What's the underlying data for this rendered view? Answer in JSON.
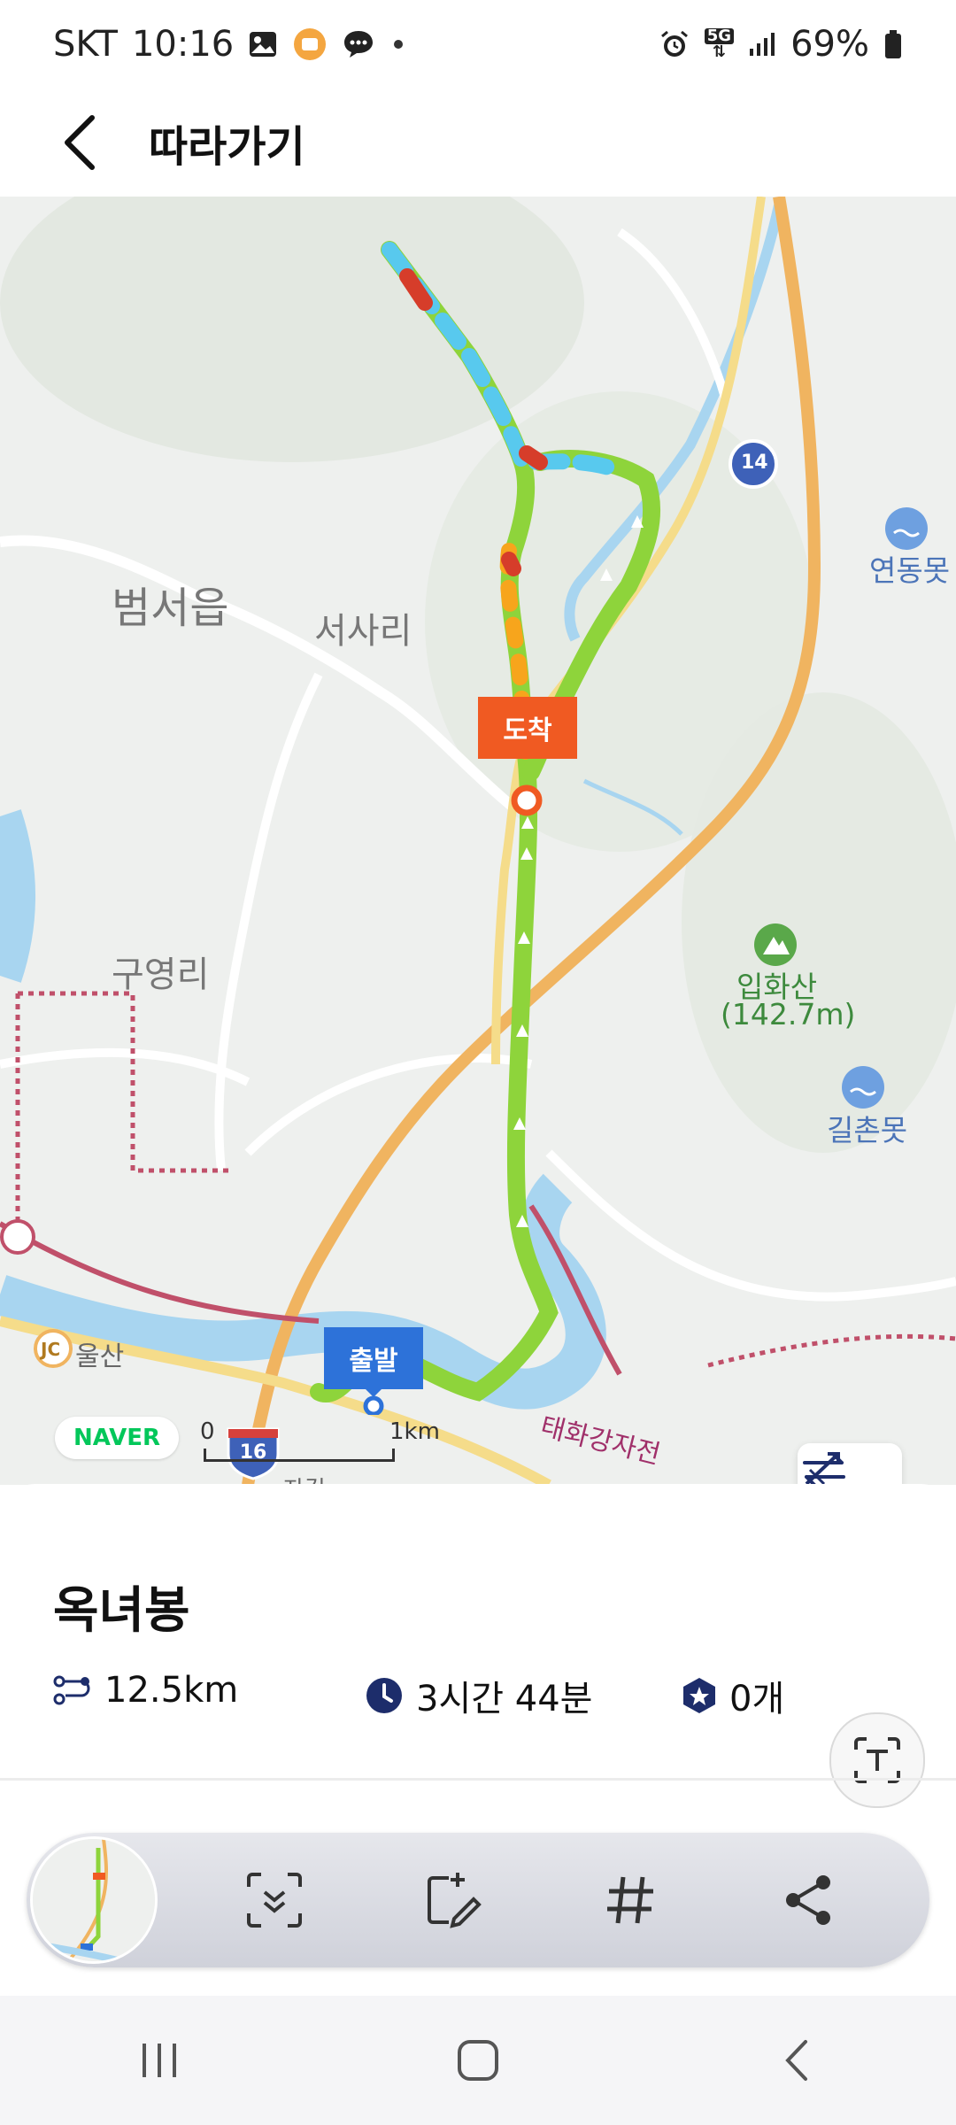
{
  "status": {
    "carrier": "SKT",
    "time": "10:16",
    "network": "5G",
    "battery": "69%",
    "left_icons": [
      "gallery-icon",
      "app-badge-icon",
      "message-icon",
      "dot-icon"
    ],
    "right_icons": [
      "alarm-icon",
      "5g-icon",
      "signal-icon",
      "battery-icon"
    ]
  },
  "header": {
    "title": "따라가기"
  },
  "map": {
    "labels": {
      "beomseo": "범서읍",
      "seosa": "서사리",
      "guyeong": "구영리",
      "ulsan": "울산",
      "jc": "JC",
      "yeondong": "연동못",
      "iphwa": "입화산",
      "iphwa_height": "(142.7m)",
      "gilchon": "길촌못",
      "road_14": "14",
      "road_16": "16",
      "taehwa": "태화강자전",
      "jagil": "자길"
    },
    "markers": {
      "arrive": "도착",
      "start": "출발"
    },
    "naver": "NAVER",
    "scale_zero": "0",
    "scale_unit": "1km"
  },
  "course": {
    "name": "옥녀봉",
    "distance": "12.5km",
    "duration": "3시간 44분",
    "stamps": "0개"
  },
  "colors": {
    "route": "#8ed43b",
    "arrive": "#f05a22",
    "start": "#2d72d9",
    "highway": "#f0b460",
    "river": "#9fd0ee"
  },
  "capture_toolbar": [
    "scroll-capture-icon",
    "edit-icon",
    "hashtag-icon",
    "share-icon"
  ],
  "nav": [
    "recent-apps-icon",
    "home-icon",
    "back-icon"
  ]
}
